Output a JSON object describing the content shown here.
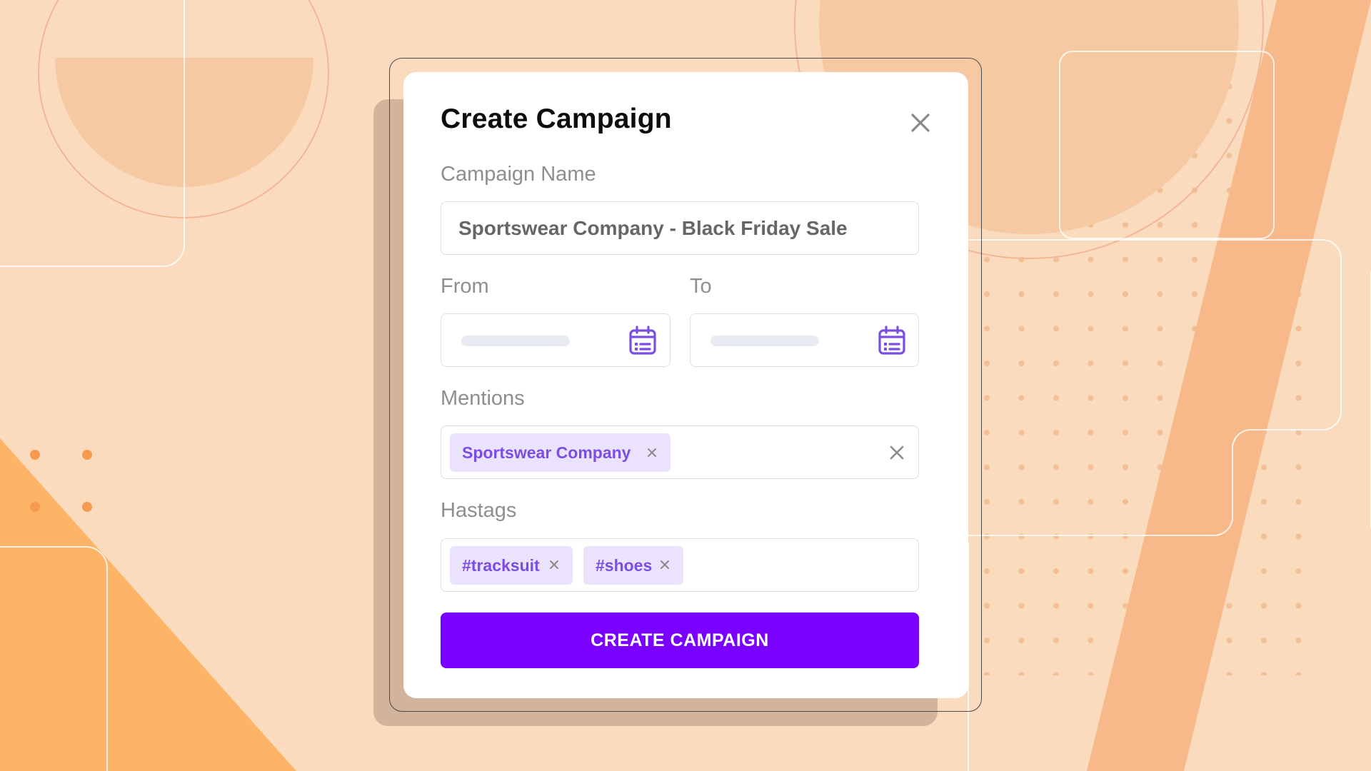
{
  "modal": {
    "title": "Create Campaign"
  },
  "campaign_name": {
    "label": "Campaign Name",
    "value": "Sportswear Company - Black Friday Sale"
  },
  "date_range": {
    "from_label": "From",
    "to_label": "To",
    "from_value": "",
    "to_value": ""
  },
  "mentions": {
    "label": "Mentions",
    "chips": [
      "Sportswear Company"
    ]
  },
  "hashtags": {
    "label": "Hastags",
    "chips": [
      "#tracksuit",
      "#shoes"
    ]
  },
  "submit": {
    "label": "CREATE CAMPAIGN"
  },
  "colors": {
    "background": "#fadbbd",
    "accent_orange": "#fdb466",
    "modal_shadow": "#d2b49d",
    "chip_background": "#ebe3fd",
    "chip_text": "#7a4ee2",
    "calendar_icon": "#7a4ee2",
    "primary_button": "#7a00ff"
  },
  "icons": {
    "close": "close-icon",
    "calendar": "calendar-icon",
    "chip_remove": "x-icon",
    "clear_all": "close-icon"
  }
}
